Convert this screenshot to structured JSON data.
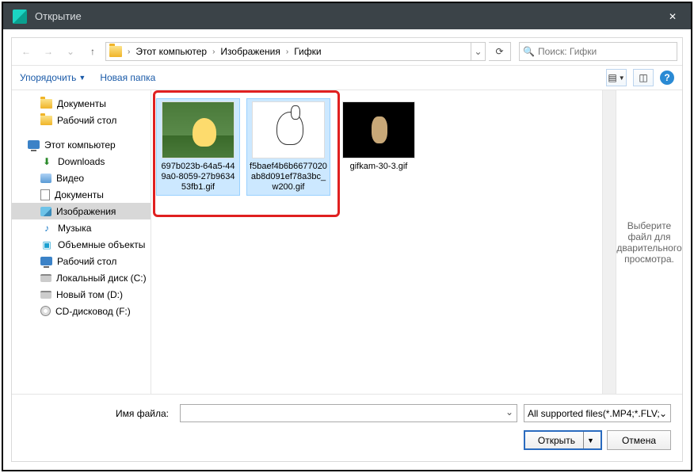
{
  "title": "Открытие",
  "breadcrumb": {
    "root": "Этот компьютер",
    "mid": "Изображения",
    "leaf": "Гифки"
  },
  "search": {
    "placeholder": "Поиск: Гифки"
  },
  "toolbar": {
    "organize": "Упорядочить",
    "newfolder": "Новая папка"
  },
  "tree": {
    "documents": "Документы",
    "desktop": "Рабочий стол",
    "thispc": "Этот компьютер",
    "downloads": "Downloads",
    "video": "Видео",
    "documents2": "Документы",
    "images": "Изображения",
    "music": "Музыка",
    "objects3d": "Объемные объекты",
    "desktop2": "Рабочий стол",
    "localdisk": "Локальный диск (C:)",
    "newvol": "Новый том (D:)",
    "cdrom": "CD-дисковод (F:)"
  },
  "files": {
    "f1": "697b023b-64a5-449a0-8059-27b963453fb1.gif",
    "f2": "f5baef4b6b6677020ab8d091ef78a3bc_w200.gif",
    "f3": "gifkam-30-3.gif"
  },
  "preview": {
    "text": "Выберите файл для дварительного просмотра."
  },
  "footer": {
    "filename_label": "Имя файла:",
    "filetype": "All supported files(*.MP4;*.FLV;",
    "open": "Открыть",
    "cancel": "Отмена"
  }
}
